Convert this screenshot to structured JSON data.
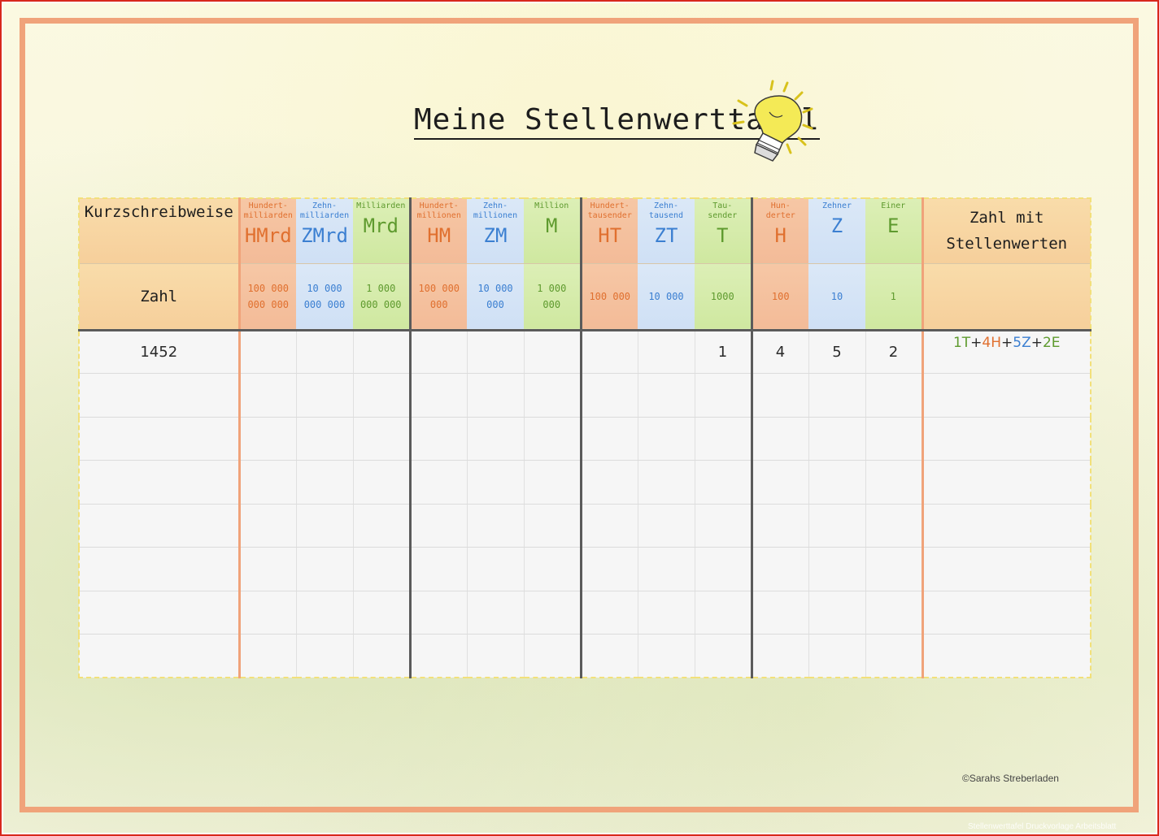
{
  "title": "Meine Stellenwerttafel",
  "header": {
    "left_top": "Kurzschreibweise",
    "left_bottom": "Zahl",
    "right_top_line1": "Zahl mit",
    "right_top_line2": "Stellenwerten",
    "columns": [
      {
        "label_line1": "Hundert-",
        "label_line2": "milliarden",
        "abbr": "HMrd",
        "value_line1": "100 000",
        "value_line2": "000 000",
        "color": "orange"
      },
      {
        "label_line1": "Zehn-",
        "label_line2": "milliarden",
        "abbr": "ZMrd",
        "value_line1": "10 000",
        "value_line2": "000 000",
        "color": "blue"
      },
      {
        "label_line1": "Milliarden",
        "label_line2": "",
        "abbr": "Mrd",
        "value_line1": "1 000",
        "value_line2": "000 000",
        "color": "green"
      },
      {
        "label_line1": "Hundert-",
        "label_line2": "millionen",
        "abbr": "HM",
        "value_line1": "100 000",
        "value_line2": "000",
        "color": "orange"
      },
      {
        "label_line1": "Zehn-",
        "label_line2": "millionen",
        "abbr": "ZM",
        "value_line1": "10 000",
        "value_line2": "000",
        "color": "blue"
      },
      {
        "label_line1": "Million",
        "label_line2": "",
        "abbr": "M",
        "value_line1": "1 000",
        "value_line2": "000",
        "color": "green"
      },
      {
        "label_line1": "Hundert-",
        "label_line2": "tausender",
        "abbr": "HT",
        "value_line1": "100 000",
        "value_line2": "",
        "color": "orange"
      },
      {
        "label_line1": "Zehn-",
        "label_line2": "tausend",
        "abbr": "ZT",
        "value_line1": "10 000",
        "value_line2": "",
        "color": "blue"
      },
      {
        "label_line1": "Tau-",
        "label_line2": "sender",
        "abbr": "T",
        "value_line1": "1000",
        "value_line2": "",
        "color": "green"
      },
      {
        "label_line1": "Hun-",
        "label_line2": "derter",
        "abbr": "H",
        "value_line1": "100",
        "value_line2": "",
        "color": "orange"
      },
      {
        "label_line1": "Zehner",
        "label_line2": "",
        "abbr": "Z",
        "value_line1": "10",
        "value_line2": "",
        "color": "blue"
      },
      {
        "label_line1": "Einer",
        "label_line2": "",
        "abbr": "E",
        "value_line1": "1",
        "value_line2": "",
        "color": "green"
      }
    ]
  },
  "rows": [
    {
      "zahl": "1452",
      "cells": [
        "",
        "",
        "",
        "",
        "",
        "",
        "",
        "",
        "1",
        "4",
        "5",
        "2"
      ],
      "stellenwerte": [
        {
          "text": "1T",
          "color": "green"
        },
        {
          "text": "+",
          "color": "black"
        },
        {
          "text": "4H",
          "color": "orange"
        },
        {
          "text": "+",
          "color": "black"
        },
        {
          "text": "5Z",
          "color": "blue"
        },
        {
          "text": "+",
          "color": "black"
        },
        {
          "text": "2E",
          "color": "green"
        }
      ]
    },
    {
      "zahl": "",
      "cells": [
        "",
        "",
        "",
        "",
        "",
        "",
        "",
        "",
        "",
        "",
        "",
        ""
      ],
      "stellenwerte": []
    },
    {
      "zahl": "",
      "cells": [
        "",
        "",
        "",
        "",
        "",
        "",
        "",
        "",
        "",
        "",
        "",
        ""
      ],
      "stellenwerte": []
    },
    {
      "zahl": "",
      "cells": [
        "",
        "",
        "",
        "",
        "",
        "",
        "",
        "",
        "",
        "",
        "",
        ""
      ],
      "stellenwerte": []
    },
    {
      "zahl": "",
      "cells": [
        "",
        "",
        "",
        "",
        "",
        "",
        "",
        "",
        "",
        "",
        "",
        ""
      ],
      "stellenwerte": []
    },
    {
      "zahl": "",
      "cells": [
        "",
        "",
        "",
        "",
        "",
        "",
        "",
        "",
        "",
        "",
        "",
        ""
      ],
      "stellenwerte": []
    },
    {
      "zahl": "",
      "cells": [
        "",
        "",
        "",
        "",
        "",
        "",
        "",
        "",
        "",
        "",
        "",
        ""
      ],
      "stellenwerte": []
    },
    {
      "zahl": "",
      "cells": [
        "",
        "",
        "",
        "",
        "",
        "",
        "",
        "",
        "",
        "",
        "",
        ""
      ],
      "stellenwerte": []
    }
  ],
  "copyright": "©Sarahs Streberladen",
  "watermark": "Stellenwerttafel Druckvorlage Arbeitsblatt",
  "colors": {
    "orange": "#e0702f",
    "blue": "#3b7fd1",
    "green": "#5e9a2e",
    "frame": "#f0a37a"
  },
  "icons": {
    "bulb": "lightbulb-icon"
  }
}
